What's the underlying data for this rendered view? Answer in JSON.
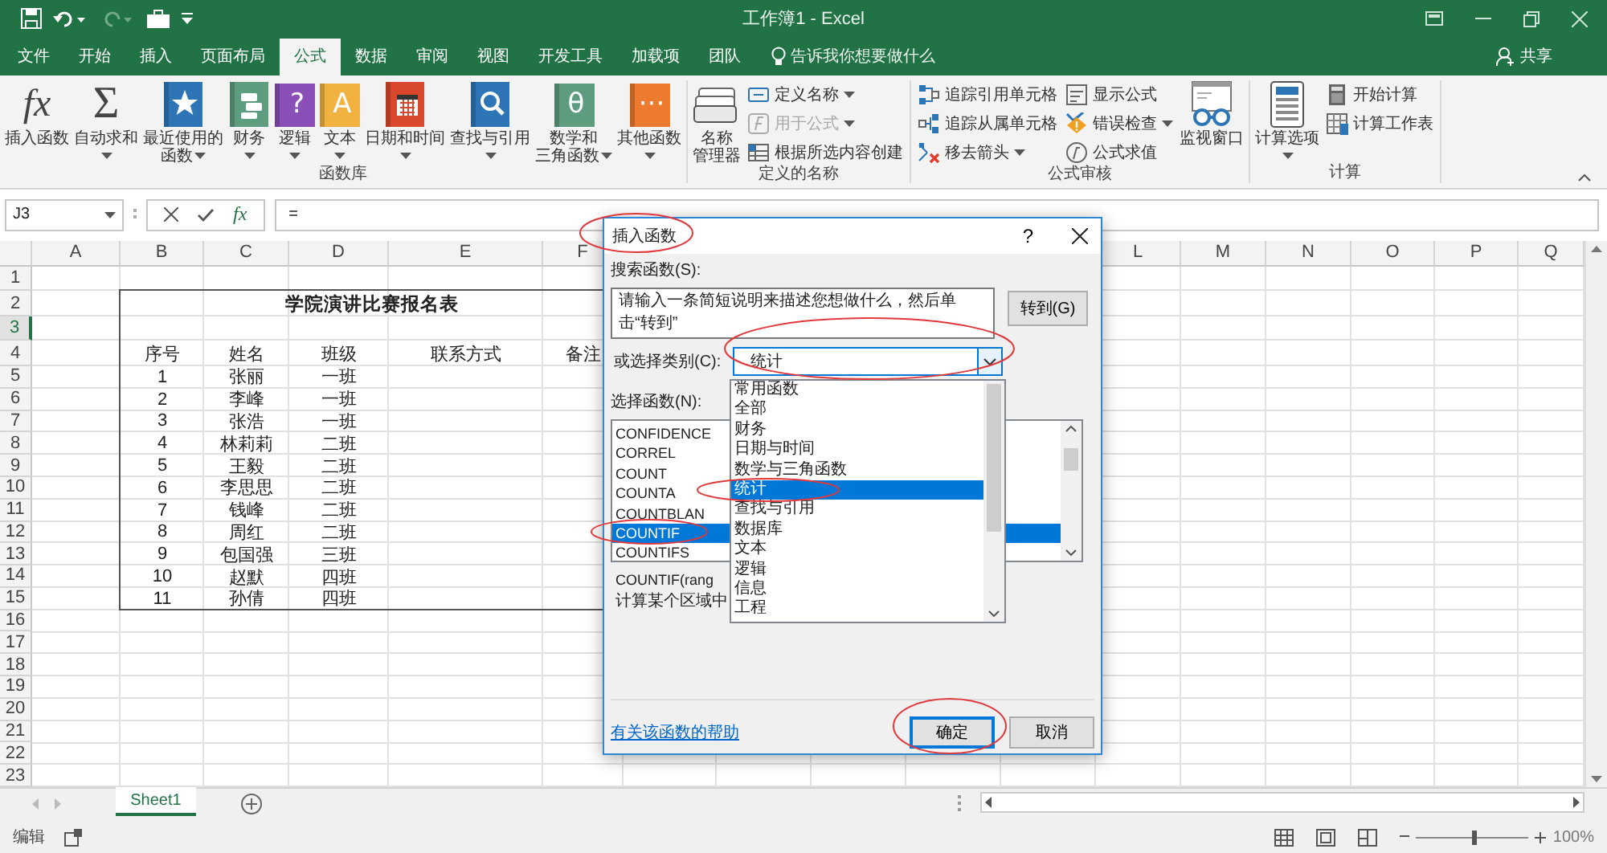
{
  "window": {
    "title": "工作簿1 - Excel"
  },
  "ribbon_tabs": [
    {
      "label": "文件",
      "selected": false
    },
    {
      "label": "开始",
      "selected": false
    },
    {
      "label": "插入",
      "selected": false
    },
    {
      "label": "页面布局",
      "selected": false
    },
    {
      "label": "公式",
      "selected": true
    },
    {
      "label": "数据",
      "selected": false
    },
    {
      "label": "审阅",
      "selected": false
    },
    {
      "label": "视图",
      "selected": false
    },
    {
      "label": "开发工具",
      "selected": false
    },
    {
      "label": "加载项",
      "selected": false
    },
    {
      "label": "团队",
      "selected": false
    }
  ],
  "tell_me": {
    "placeholder": "告诉我你想要做什么"
  },
  "share": "共享",
  "ribbon": {
    "groups": [
      {
        "label": "函数库",
        "items": [
          {
            "kind": "large",
            "glyph": "fx",
            "lines": [
              "插入函数"
            ],
            "dropdown": false
          },
          {
            "kind": "large",
            "glyph": "Σ",
            "lines": [
              "自动求和"
            ],
            "dropdown": true
          },
          {
            "kind": "large",
            "color": "#2e75b6",
            "lines": [
              "最近使用的",
              "函数"
            ],
            "dropdown": true
          },
          {
            "kind": "large",
            "color": "#5e9c80",
            "lines": [
              "财务"
            ],
            "dropdown": true
          },
          {
            "kind": "large",
            "color": "#8b4fb8",
            "glyph": "?",
            "lines": [
              "逻辑"
            ],
            "dropdown": true
          },
          {
            "kind": "large",
            "color": "#f2b240",
            "glyph": "A",
            "lines": [
              "文本"
            ],
            "dropdown": true
          },
          {
            "kind": "large",
            "color": "#d9482c",
            "lines": [
              "日期和时间"
            ],
            "dropdown": true
          },
          {
            "kind": "large",
            "color": "#2e75b6",
            "lines": [
              "查找与引用"
            ],
            "dropdown": true
          },
          {
            "kind": "large",
            "color": "#5e9c80",
            "glyph": "θ",
            "lines": [
              "数学和",
              "三角函数"
            ],
            "dropdown": true
          },
          {
            "kind": "large",
            "color": "#ec7a2f",
            "glyph": "···",
            "lines": [
              "其他函数"
            ],
            "dropdown": true
          }
        ]
      },
      {
        "label": "定义的名称",
        "items": [
          {
            "kind": "large",
            "lines": [
              "名称",
              "管理器"
            ],
            "dropdown": false
          },
          {
            "kind": "stack",
            "items": [
              {
                "label": "定义名称",
                "dropdown": true,
                "disabled": false
              },
              {
                "label": "用于公式",
                "dropdown": true,
                "disabled": true
              },
              {
                "label": "根据所选内容创建",
                "dropdown": false,
                "disabled": false
              }
            ]
          }
        ]
      },
      {
        "label": "公式审核",
        "items": [
          {
            "kind": "stack",
            "items": [
              {
                "label": "追踪引用单元格",
                "dropdown": false,
                "disabled": false
              },
              {
                "label": "追踪从属单元格",
                "dropdown": false,
                "disabled": false
              },
              {
                "label": "移去箭头",
                "dropdown": true,
                "disabled": false
              }
            ]
          },
          {
            "kind": "stack",
            "items": [
              {
                "label": "显示公式",
                "dropdown": false,
                "disabled": false
              },
              {
                "label": "错误检查",
                "dropdown": true,
                "disabled": false
              },
              {
                "label": "公式求值",
                "dropdown": false,
                "disabled": false
              }
            ]
          },
          {
            "kind": "large",
            "lines": [
              "监视窗口"
            ],
            "dropdown": false
          }
        ]
      },
      {
        "label": "计算",
        "items": [
          {
            "kind": "large",
            "lines": [
              "计算选项"
            ],
            "dropdown": true
          },
          {
            "kind": "stack",
            "items": [
              {
                "label": "开始计算",
                "dropdown": false,
                "disabled": false
              },
              {
                "label": "计算工作表",
                "dropdown": false,
                "disabled": false
              }
            ]
          }
        ]
      }
    ]
  },
  "formula_bar": {
    "name_box": "J3",
    "fx": "fx",
    "formula": "="
  },
  "sheet": {
    "columns_left": [
      "A",
      "B",
      "C",
      "D",
      "E",
      "F"
    ],
    "columns_right": [
      "L",
      "M",
      "N",
      "O",
      "P",
      "Q"
    ],
    "rows": [
      {
        "label": "1",
        "selected": false
      },
      {
        "label": "2",
        "selected": false
      },
      {
        "label": "3",
        "selected": true
      },
      {
        "label": "4",
        "selected": false
      },
      {
        "label": "5",
        "selected": false
      },
      {
        "label": "6",
        "selected": false
      },
      {
        "label": "7",
        "selected": false
      },
      {
        "label": "8",
        "selected": false
      },
      {
        "label": "9",
        "selected": false
      },
      {
        "label": "10",
        "selected": false
      },
      {
        "label": "11",
        "selected": false
      },
      {
        "label": "12",
        "selected": false
      },
      {
        "label": "13",
        "selected": false
      },
      {
        "label": "14",
        "selected": false
      },
      {
        "label": "15",
        "selected": false
      },
      {
        "label": "16",
        "selected": false
      },
      {
        "label": "17",
        "selected": false
      },
      {
        "label": "18",
        "selected": false
      },
      {
        "label": "19",
        "selected": false
      },
      {
        "label": "20",
        "selected": false
      },
      {
        "label": "21",
        "selected": false
      },
      {
        "label": "22",
        "selected": false
      },
      {
        "label": "23",
        "selected": false
      }
    ],
    "table": {
      "title": "学院演讲比赛报名表",
      "headers": [
        "序号",
        "姓名",
        "班级",
        "联系方式",
        "备注"
      ],
      "rows": [
        [
          "1",
          "张丽",
          "一班"
        ],
        [
          "2",
          "李峰",
          "一班"
        ],
        [
          "3",
          "张浩",
          "一班"
        ],
        [
          "4",
          "林莉莉",
          "二班"
        ],
        [
          "5",
          "王毅",
          "二班"
        ],
        [
          "6",
          "李思思",
          "二班"
        ],
        [
          "7",
          "钱峰",
          "二班"
        ],
        [
          "8",
          "周红",
          "二班"
        ],
        [
          "9",
          "包国强",
          "三班"
        ],
        [
          "10",
          "赵默",
          "四班"
        ],
        [
          "11",
          "孙倩",
          "四班"
        ]
      ]
    }
  },
  "sheet_tabs": [
    {
      "label": "Sheet1",
      "selected": true
    }
  ],
  "status_bar": {
    "mode": "编辑",
    "zoom": {
      "level": 0.5,
      "label": "100%"
    }
  },
  "dialog": {
    "title": "插入函数",
    "help": "?",
    "search_label": "搜索函数(S):",
    "search_value": "请输入一条简短说明来描述您想做什么，然后单击“转到”",
    "go": "转到(G)",
    "category": {
      "label": "或选择类别(C):",
      "value": "统计",
      "options": [
        {
          "label": "常用函数",
          "selected": false
        },
        {
          "label": "全部",
          "selected": false
        },
        {
          "label": "财务",
          "selected": false
        },
        {
          "label": "日期与时间",
          "selected": false
        },
        {
          "label": "数学与三角函数",
          "selected": false
        },
        {
          "label": "统计",
          "selected": true
        },
        {
          "label": "查找与引用",
          "selected": false
        },
        {
          "label": "数据库",
          "selected": false
        },
        {
          "label": "文本",
          "selected": false
        },
        {
          "label": "逻辑",
          "selected": false
        },
        {
          "label": "信息",
          "selected": false
        },
        {
          "label": "工程",
          "selected": false
        }
      ]
    },
    "functions_label": "选择函数(N):",
    "functions": [
      {
        "label": "CONFIDENCE",
        "selected": false
      },
      {
        "label": "CORREL",
        "selected": false
      },
      {
        "label": "COUNT",
        "selected": false
      },
      {
        "label": "COUNTA",
        "selected": false
      },
      {
        "label": "COUNTBLAN",
        "selected": false
      },
      {
        "label": "COUNTIF",
        "selected": true
      },
      {
        "label": "COUNTIFS",
        "selected": false
      }
    ],
    "syntax": "COUNTIF(rang",
    "description": "计算某个区域中",
    "help_link": "有关该函数的帮助",
    "buttons": [
      {
        "label": "确定",
        "default": true
      },
      {
        "label": "取消",
        "default": false
      }
    ]
  }
}
